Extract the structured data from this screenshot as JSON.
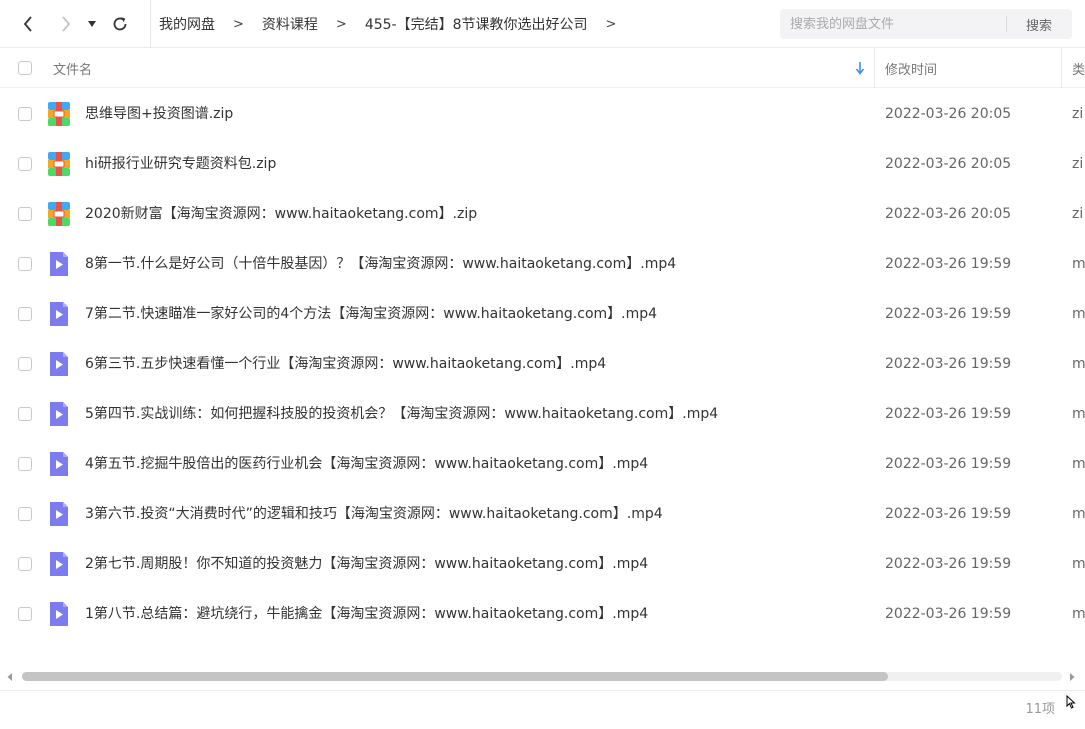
{
  "breadcrumb": [
    "我的网盘",
    "资料课程",
    "455-【完结】8节课教你选出好公司"
  ],
  "search": {
    "placeholder": "搜索我的网盘文件",
    "button_label": "搜索"
  },
  "columns": {
    "name": "文件名",
    "modified": "修改时间",
    "type": "类"
  },
  "files": [
    {
      "name": "思维导图+投资图谱.zip",
      "modified": "2022-03-26 20:05",
      "type": "zi",
      "icon": "archive-icon"
    },
    {
      "name": "hi研报行业研究专题资料包.zip",
      "modified": "2022-03-26 20:05",
      "type": "zi",
      "icon": "archive-icon"
    },
    {
      "name": "2020新财富【海淘宝资源网：www.haitaoketang.com】.zip",
      "modified": "2022-03-26 20:05",
      "type": "zi",
      "icon": "archive-icon"
    },
    {
      "name": "8第一节.什么是好公司（十倍牛股基因）？【海淘宝资源网：www.haitaoketang.com】.mp4",
      "modified": "2022-03-26 19:59",
      "type": "m",
      "icon": "video-icon"
    },
    {
      "name": "7第二节.快速瞄准一家好公司的4个方法【海淘宝资源网：www.haitaoketang.com】.mp4",
      "modified": "2022-03-26 19:59",
      "type": "m",
      "icon": "video-icon"
    },
    {
      "name": "6第三节.五步快速看懂一个行业【海淘宝资源网：www.haitaoketang.com】.mp4",
      "modified": "2022-03-26 19:59",
      "type": "m",
      "icon": "video-icon"
    },
    {
      "name": "5第四节.实战训练：如何把握科技股的投资机会？【海淘宝资源网：www.haitaoketang.com】.mp4",
      "modified": "2022-03-26 19:59",
      "type": "m",
      "icon": "video-icon"
    },
    {
      "name": "4第五节.挖掘牛股倍出的医药行业机会【海淘宝资源网：www.haitaoketang.com】.mp4",
      "modified": "2022-03-26 19:59",
      "type": "m",
      "icon": "video-icon"
    },
    {
      "name": "3第六节.投资“大消费时代”的逻辑和技巧【海淘宝资源网：www.haitaoketang.com】.mp4",
      "modified": "2022-03-26 19:59",
      "type": "m",
      "icon": "video-icon"
    },
    {
      "name": "2第七节.周期股！你不知道的投资魅力【海淘宝资源网：www.haitaoketang.com】.mp4",
      "modified": "2022-03-26 19:59",
      "type": "m",
      "icon": "video-icon"
    },
    {
      "name": "1第八节.总结篇：避坑绕行，牛能擒金【海淘宝资源网：www.haitaoketang.com】.mp4",
      "modified": "2022-03-26 19:59",
      "type": "m",
      "icon": "video-icon"
    }
  ],
  "footer": {
    "count": "11项"
  },
  "colors": {
    "accent": "#3b8cf5",
    "archive_top": "#3fa9f5",
    "archive_mid": "#f5a623",
    "archive_bottom": "#4cd964",
    "archive_band": "#e8524a",
    "video": "#7c7cf0"
  }
}
